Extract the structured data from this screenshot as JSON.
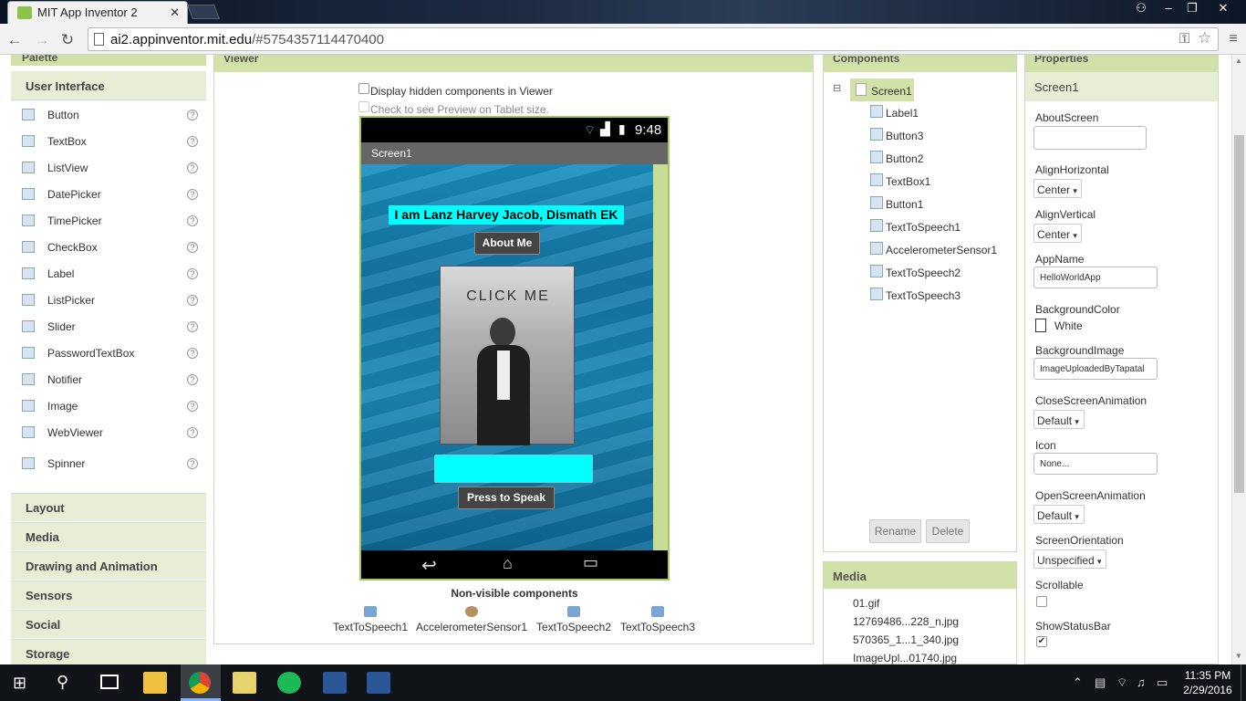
{
  "browser": {
    "tab_title": "MIT App Inventor 2",
    "url_host": "ai2.appinventor.mit.edu",
    "url_path": "/#5754357114470400"
  },
  "palette": {
    "title": "Palette",
    "category_open": "User Interface",
    "items": [
      {
        "label": "Button",
        "icon": "button-icon"
      },
      {
        "label": "TextBox",
        "icon": "textbox-icon"
      },
      {
        "label": "ListView",
        "icon": "listview-icon"
      },
      {
        "label": "DatePicker",
        "icon": "datepicker-icon"
      },
      {
        "label": "TimePicker",
        "icon": "timepicker-icon"
      },
      {
        "label": "CheckBox",
        "icon": "checkbox-icon"
      },
      {
        "label": "Label",
        "icon": "label-icon"
      },
      {
        "label": "ListPicker",
        "icon": "listpicker-icon"
      },
      {
        "label": "Slider",
        "icon": "slider-icon"
      },
      {
        "label": "PasswordTextBox",
        "icon": "password-icon"
      },
      {
        "label": "Notifier",
        "icon": "notifier-icon"
      },
      {
        "label": "Image",
        "icon": "image-icon"
      },
      {
        "label": "WebViewer",
        "icon": "webviewer-icon"
      },
      {
        "label": "Spinner",
        "icon": "spinner-icon"
      }
    ],
    "help_glyph": "?",
    "categories": [
      "Layout",
      "Media",
      "Drawing and Animation",
      "Sensors",
      "Social",
      "Storage"
    ]
  },
  "viewer": {
    "title": "Viewer",
    "show_hidden_label": "Display hidden components in Viewer",
    "tablet_preview_label": "Check to see Preview on Tablet size.",
    "phone": {
      "time": "9:48",
      "screen_title": "Screen1",
      "label_text": "I am Lanz Harvey Jacob, Dismath EK",
      "about_button": "About Me",
      "image_caption": "CLICK ME",
      "speak_button": "Press to Speak"
    },
    "nonvisible_title": "Non-visible components",
    "nonvisible": [
      "TextToSpeech1",
      "AccelerometerSensor1",
      "TextToSpeech2",
      "TextToSpeech3"
    ]
  },
  "components": {
    "title": "Components",
    "root": "Screen1",
    "collapse_glyph": "⊟",
    "children": [
      "Label1",
      "Button3",
      "Button2",
      "TextBox1",
      "Button1",
      "TextToSpeech1",
      "AccelerometerSensor1",
      "TextToSpeech2",
      "TextToSpeech3"
    ],
    "rename_label": "Rename",
    "delete_label": "Delete"
  },
  "media": {
    "title": "Media",
    "files": [
      "01.gif",
      "12769486...228_n.jpg",
      "570365_1...1_340.jpg",
      "ImageUpl...01740.jpg"
    ]
  },
  "properties": {
    "title": "Properties",
    "selected": "Screen1",
    "about_screen_label": "AboutScreen",
    "about_screen_value": "",
    "align_h_label": "AlignHorizontal",
    "align_h_value": "Center",
    "align_v_label": "AlignVertical",
    "align_v_value": "Center",
    "app_name_label": "AppName",
    "app_name_value": "HelloWorldApp",
    "bg_color_label": "BackgroundColor",
    "bg_color_value": "White",
    "bg_image_label": "BackgroundImage",
    "bg_image_value": "ImageUploadedByTapatal",
    "close_anim_label": "CloseScreenAnimation",
    "close_anim_value": "Default",
    "icon_label": "Icon",
    "icon_value": "None...",
    "open_anim_label": "OpenScreenAnimation",
    "open_anim_value": "Default",
    "orientation_label": "ScreenOrientation",
    "orientation_value": "Unspecified",
    "scrollable_label": "Scrollable",
    "scrollable_checked": false,
    "status_bar_label": "ShowStatusBar",
    "status_bar_checked": true,
    "dropdown_glyph": "▾",
    "check_glyph": "✔"
  },
  "taskbar": {
    "time": "11:35 PM",
    "date": "2/29/2016"
  },
  "colors": {
    "panel_header": "#d2e1a8",
    "cyan": "#00ffff",
    "phone_border": "#a0c85a"
  }
}
